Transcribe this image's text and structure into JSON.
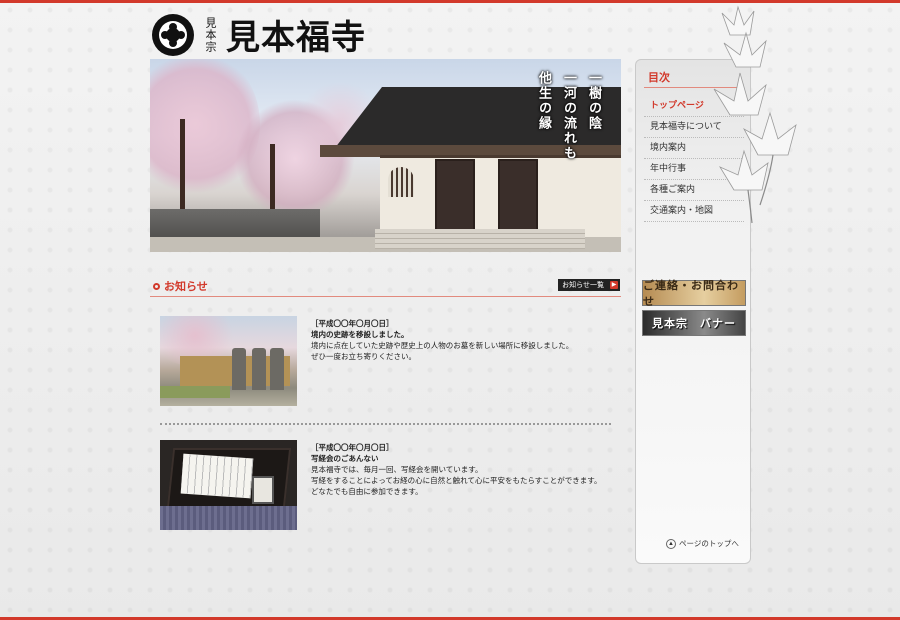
{
  "header": {
    "sect": "見本宗",
    "temple_name": "見本福寺"
  },
  "hero": {
    "poem_lines": [
      "一樹の陰",
      "一河の流れも",
      "他生の縁"
    ]
  },
  "news": {
    "title": "お知らせ",
    "more_label": "お知らせ一覧",
    "items": [
      {
        "date": "［平成〇〇年〇月〇日］",
        "subject": "境内の史跡を移設しました。",
        "body": [
          "境内に点在していた史跡や歴史上の人物のお墓を新しい場所に移設しました。",
          "ぜひ一度お立ち寄りください。"
        ]
      },
      {
        "date": "［平成〇〇年〇月〇日］",
        "subject": "写経会のごあんない",
        "body": [
          "見本福寺では、毎月一回、写経会を開いています。",
          "写経をすることによってお経の心に自然と触れて心に平安をもたらすことができます。",
          "どなたでも自由に参加できます。"
        ]
      }
    ]
  },
  "sidebar": {
    "title": "目次",
    "menu": [
      "トップページ",
      "見本福寺について",
      "境内案内",
      "年中行事",
      "各種ご案内",
      "交通案内・地図"
    ],
    "active_index": 0,
    "banners": [
      "ご連絡・お問合わせ",
      "見本宗　バナー"
    ],
    "pagetop_label": "ページのトップへ"
  },
  "colors": {
    "accent": "#d2392b",
    "text": "#222222"
  }
}
